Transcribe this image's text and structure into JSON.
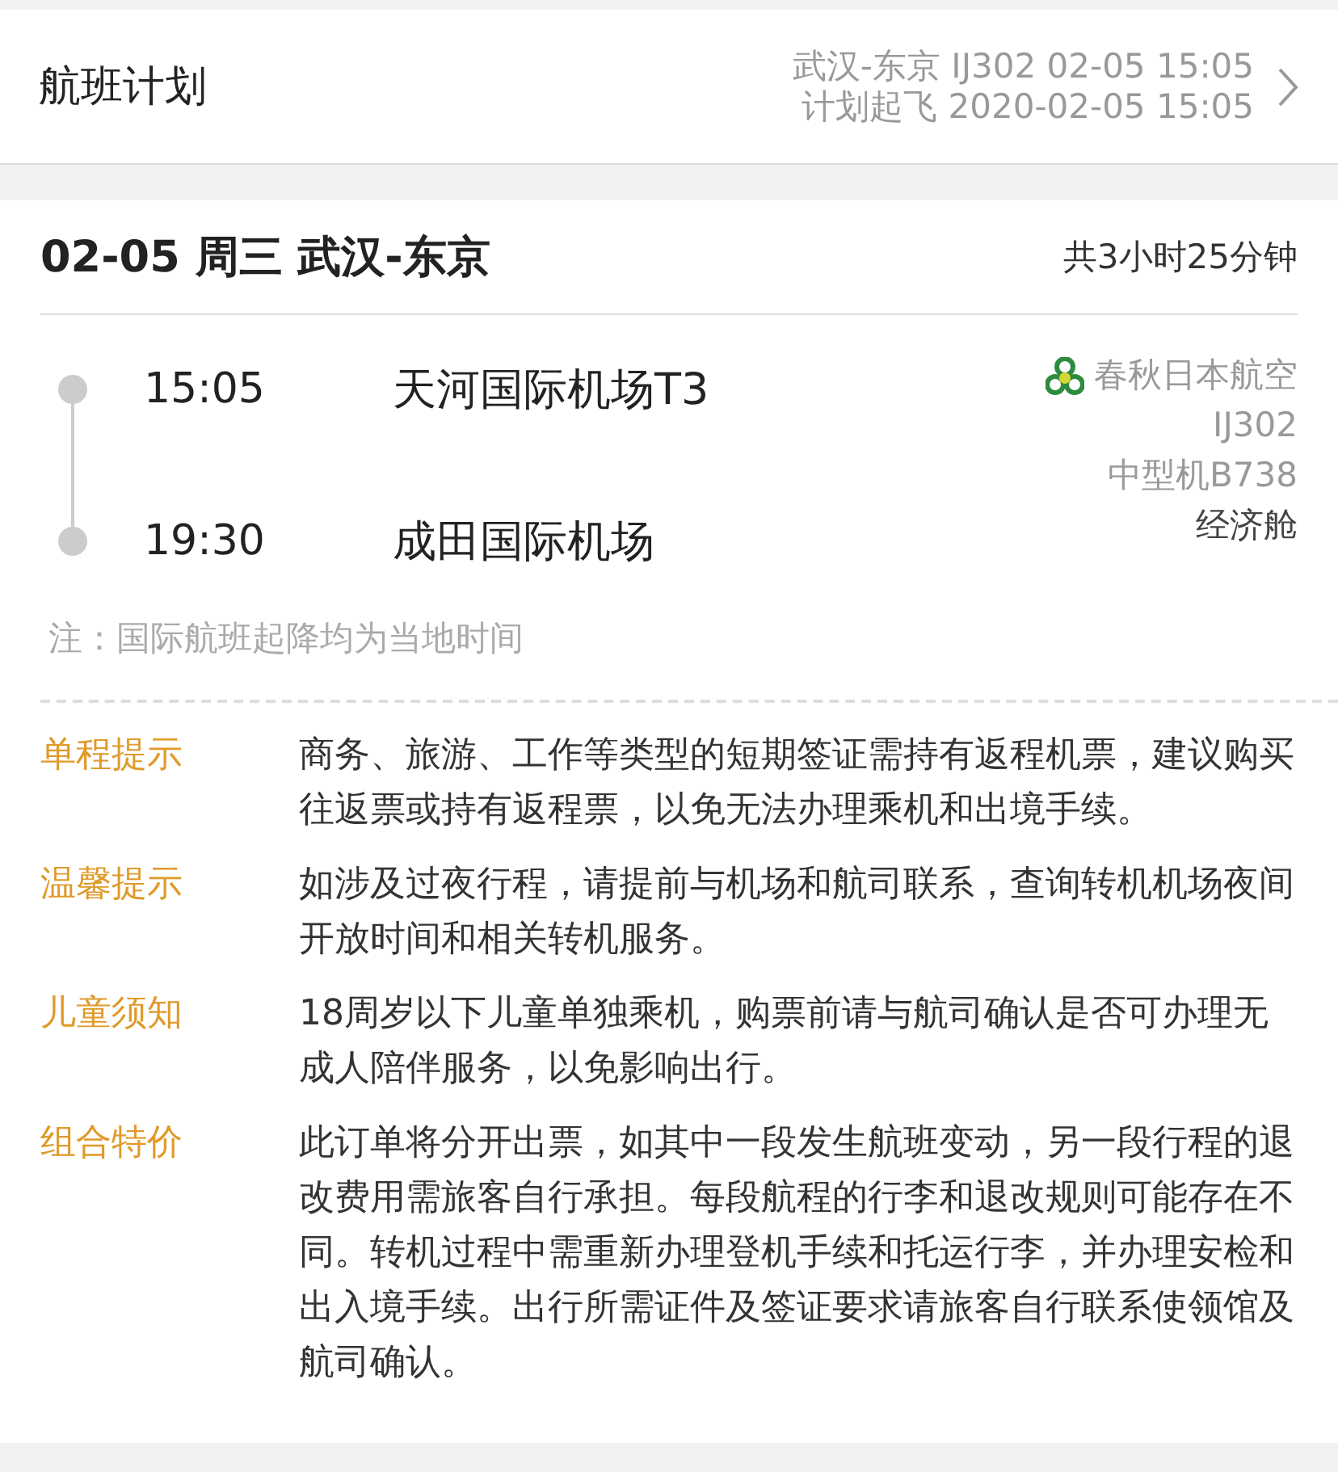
{
  "header": {
    "title": "航班计划",
    "summary_line_1": "武汉-东京 IJ302 02-05 15:05",
    "summary_line_2": "计划起飞 2020-02-05 15:05"
  },
  "segment": {
    "title": "02-05 周三 武汉-东京",
    "duration": "共3小时25分钟",
    "stops": [
      {
        "time": "15:05",
        "airport": "天河国际机场T3"
      },
      {
        "time": "19:30",
        "airport": "成田国际机场"
      }
    ],
    "airline": "春秋日本航空",
    "flight_no": "IJ302",
    "aircraft": "中型机B738",
    "cabin": "经济舱"
  },
  "note": "注：国际航班起降均为当地时间",
  "notices": [
    {
      "label": "单程提示",
      "text": "商务、旅游、工作等类型的短期签证需持有返程机票，建议购买往返票或持有返程票，以免无法办理乘机和出境手续。"
    },
    {
      "label": "温馨提示",
      "text": "如涉及过夜行程，请提前与机场和航司联系，查询转机机场夜间开放时间和相关转机服务。"
    },
    {
      "label": "儿童须知",
      "text": "18周岁以下儿童单独乘机，购票前请与航司确认是否可办理无成人陪伴服务，以免影响出行。"
    },
    {
      "label": "组合特价",
      "text": "此订单将分开出票，如其中一段发生航班变动，另一段行程的退改费用需旅客自行承担。每段航程的行李和退改规则可能存在不同。转机过程中需重新办理登机手续和托运行李，并办理安检和出入境手续。出行所需证件及签证要求请旅客自行联系使领馆及航司确认。"
    }
  ]
}
